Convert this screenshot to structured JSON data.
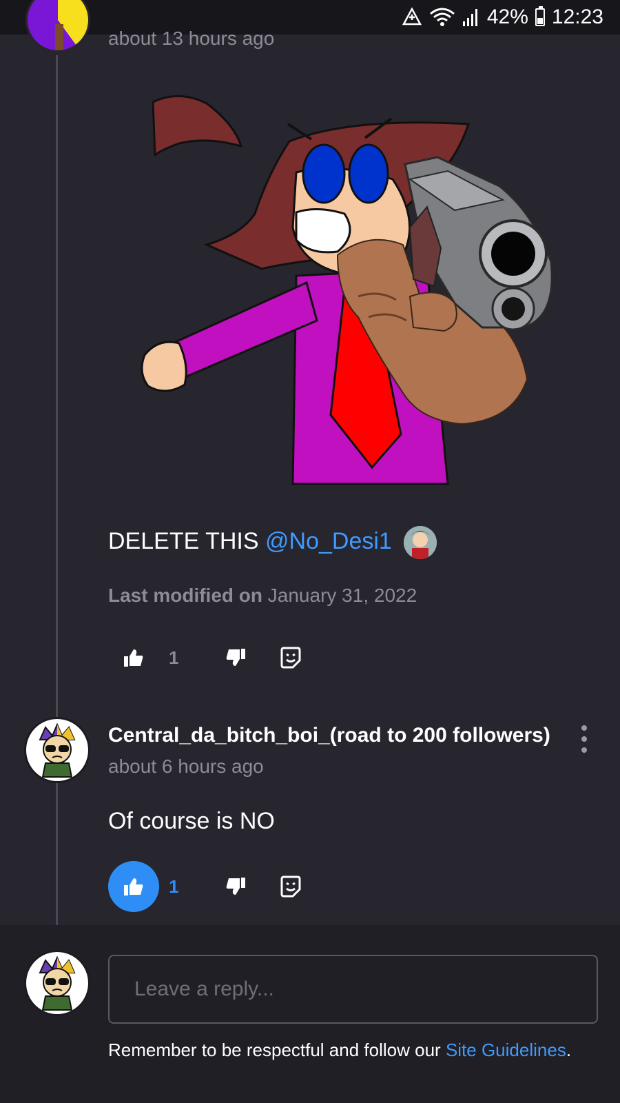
{
  "status_bar": {
    "battery_percent": "42%",
    "time": "12:23",
    "icons": [
      "data-saver-icon",
      "wifi-icon",
      "signal-icon",
      "battery-icon"
    ]
  },
  "comments": [
    {
      "timestamp": "about 13 hours ago",
      "text": "DELETE THIS",
      "mention": "@No_Desi1",
      "modified_label": "Last modified on",
      "modified_date": "January 31, 2022",
      "like_count": "1",
      "liked": false
    },
    {
      "username": "Central_da_bitch_boi_(road to 200 followers)",
      "timestamp": "about 6 hours ago",
      "text": "Of course is NO",
      "like_count": "1",
      "liked": true
    }
  ],
  "reply": {
    "placeholder": "Leave a reply...",
    "guidelines_text": "Remember to be respectful and follow our",
    "guidelines_link": "Site Guidelines",
    "guidelines_end": "."
  },
  "colors": {
    "background": "#27252e",
    "accent": "#2f8ef5",
    "link": "#3f9bff",
    "muted": "#8d8b96"
  }
}
